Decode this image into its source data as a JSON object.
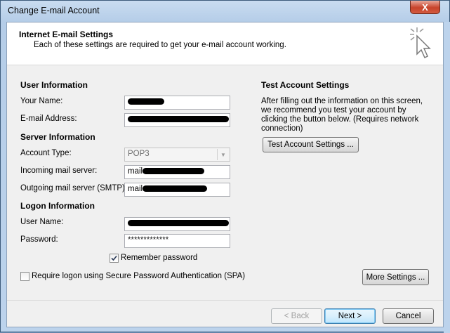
{
  "window": {
    "title": "Change E-mail Account",
    "close_label": "X"
  },
  "header": {
    "title": "Internet E-mail Settings",
    "subtitle": "Each of these settings are required to get your e-mail account working."
  },
  "user_info": {
    "section_title": "User Information",
    "name_label": "Your Name:",
    "email_label": "E-mail Address:"
  },
  "server_info": {
    "section_title": "Server Information",
    "account_type_label": "Account Type:",
    "account_type_value": "POP3",
    "incoming_label": "Incoming mail server:",
    "incoming_prefix": "mail",
    "outgoing_label": "Outgoing mail server (SMTP):",
    "outgoing_prefix": "mail"
  },
  "logon_info": {
    "section_title": "Logon Information",
    "username_label": "User Name:",
    "password_label": "Password:",
    "password_value": "*************",
    "remember_label": "Remember password",
    "remember_checked": true,
    "spa_label": "Require logon using Secure Password Authentication (SPA)",
    "spa_checked": false
  },
  "test_settings": {
    "section_title": "Test Account Settings",
    "description": "After filling out the information on this screen, we recommend you test your account by clicking the button below. (Requires network connection)",
    "button_label": "Test Account Settings ..."
  },
  "buttons": {
    "more_settings": "More Settings ...",
    "back": "< Back",
    "next": "Next >",
    "cancel": "Cancel"
  }
}
